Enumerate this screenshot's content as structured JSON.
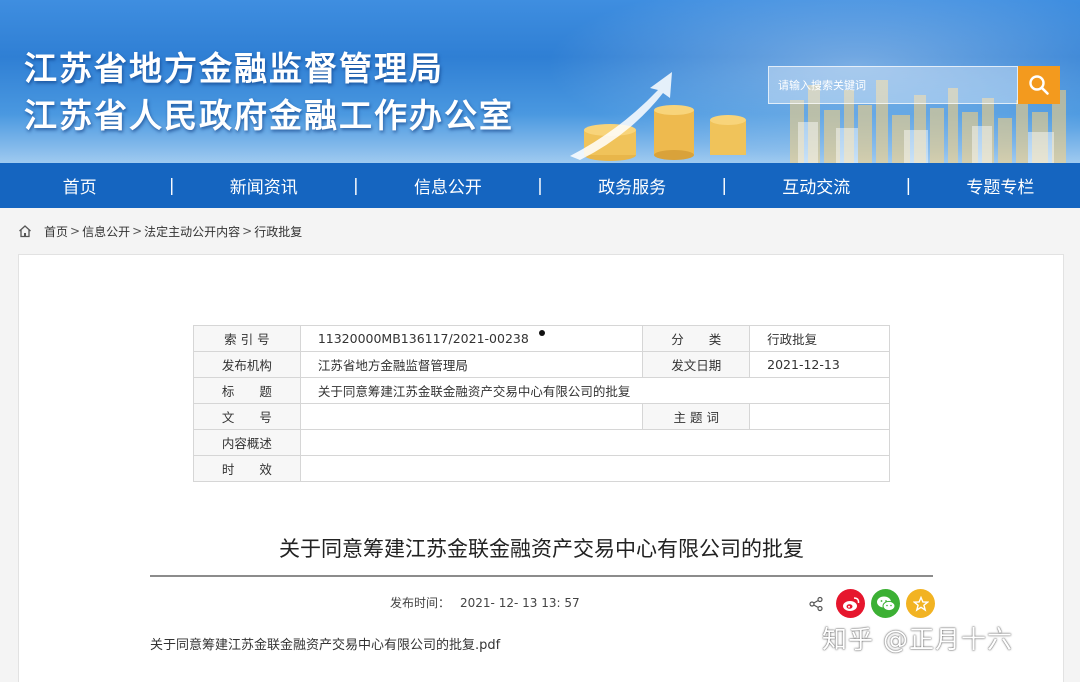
{
  "header": {
    "title_line1": "江苏省地方金融监督管理局",
    "title_line2": "江苏省人民政府金融工作办公室",
    "search_placeholder": "请输入搜索关键词"
  },
  "nav": {
    "items": [
      "首页",
      "新闻资讯",
      "信息公开",
      "政务服务",
      "互动交流",
      "专题专栏"
    ],
    "separator": "|"
  },
  "breadcrumb": {
    "items": [
      "首页",
      "信息公开",
      "法定主动公开内容",
      "行政批复"
    ],
    "separator": ">"
  },
  "meta": {
    "index_label": "索 引 号",
    "index_value": "11320000MB136117/2021-00238",
    "category_label": "分　　类",
    "category_value": "行政批复",
    "publisher_label": "发布机构",
    "publisher_value": "江苏省地方金融监督管理局",
    "date_label": "发文日期",
    "date_value": "2021-12-13",
    "title_label": "标　　题",
    "title_value": "关于同意筹建江苏金联金融资产交易中心有限公司的批复",
    "docnum_label": "文　　号",
    "docnum_value": "",
    "keywords_label": "主 题 词",
    "keywords_value": "",
    "summary_label": "内容概述",
    "summary_value": "",
    "validity_label": "时　　效",
    "validity_value": ""
  },
  "article": {
    "title": "关于同意筹建江苏金联金融资产交易中心有限公司的批复",
    "publish_label": "发布时间：",
    "publish_time": "2021- 12- 13 13: 57",
    "attachment": "关于同意筹建江苏金联金融资产交易中心有限公司的批复.pdf"
  },
  "share": {
    "icons": [
      "share-icon",
      "weibo-icon",
      "wechat-icon",
      "favorite-icon"
    ],
    "colors": {
      "weibo": "#e6162d",
      "wechat": "#3cb034",
      "favorite": "#f2b322"
    }
  },
  "watermark": "知乎 @正月十六",
  "colors": {
    "nav_bg": "#1565c0",
    "search_button": "#f39a1e",
    "banner_blue": "#2f7fd4"
  }
}
